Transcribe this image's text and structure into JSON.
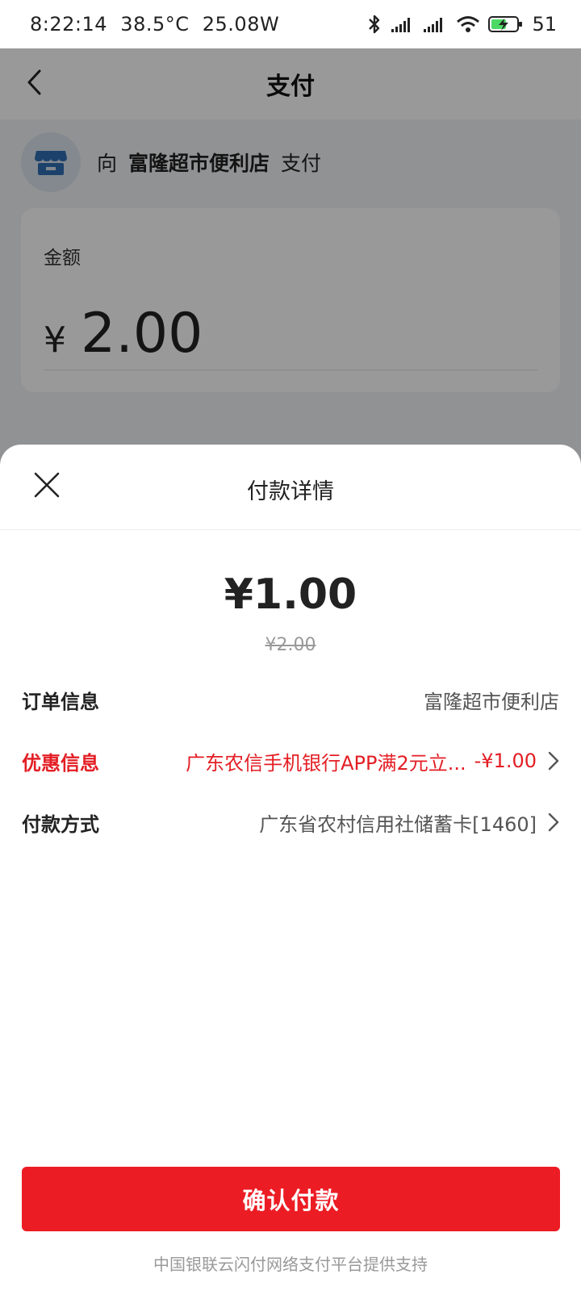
{
  "status_bar": {
    "time": "8:22:14",
    "temperature": "38.5°C",
    "power": "25.08W",
    "battery_level": "51",
    "icons": [
      "bluetooth-icon",
      "signal-icon",
      "signal-icon",
      "wifi-icon",
      "battery-charging-icon"
    ]
  },
  "background_page": {
    "title": "支付",
    "merchant": {
      "prefix": "向",
      "name": "富隆超市便利店",
      "suffix": "支付"
    },
    "amount_label": "金额",
    "currency_symbol": "¥",
    "amount_value": "2.00"
  },
  "sheet": {
    "title": "付款详情",
    "final_amount": "¥1.00",
    "original_amount": "¥2.00",
    "rows": {
      "order": {
        "label": "订单信息",
        "value": "富隆超市便利店"
      },
      "discount": {
        "label": "优惠信息",
        "description": "广东农信手机银行APP满2元立...",
        "amount": "-¥1.00"
      },
      "method": {
        "label": "付款方式",
        "value": "广东省农村信用社储蓄卡[1460]"
      }
    },
    "confirm_label": "确认付款",
    "footer": "中国银联云闪付网络支付平台提供支持"
  },
  "colors": {
    "accent_red": "#ec1c24",
    "discount_red": "#e31e24",
    "overlay": "rgba(0,0,0,0.4)"
  }
}
